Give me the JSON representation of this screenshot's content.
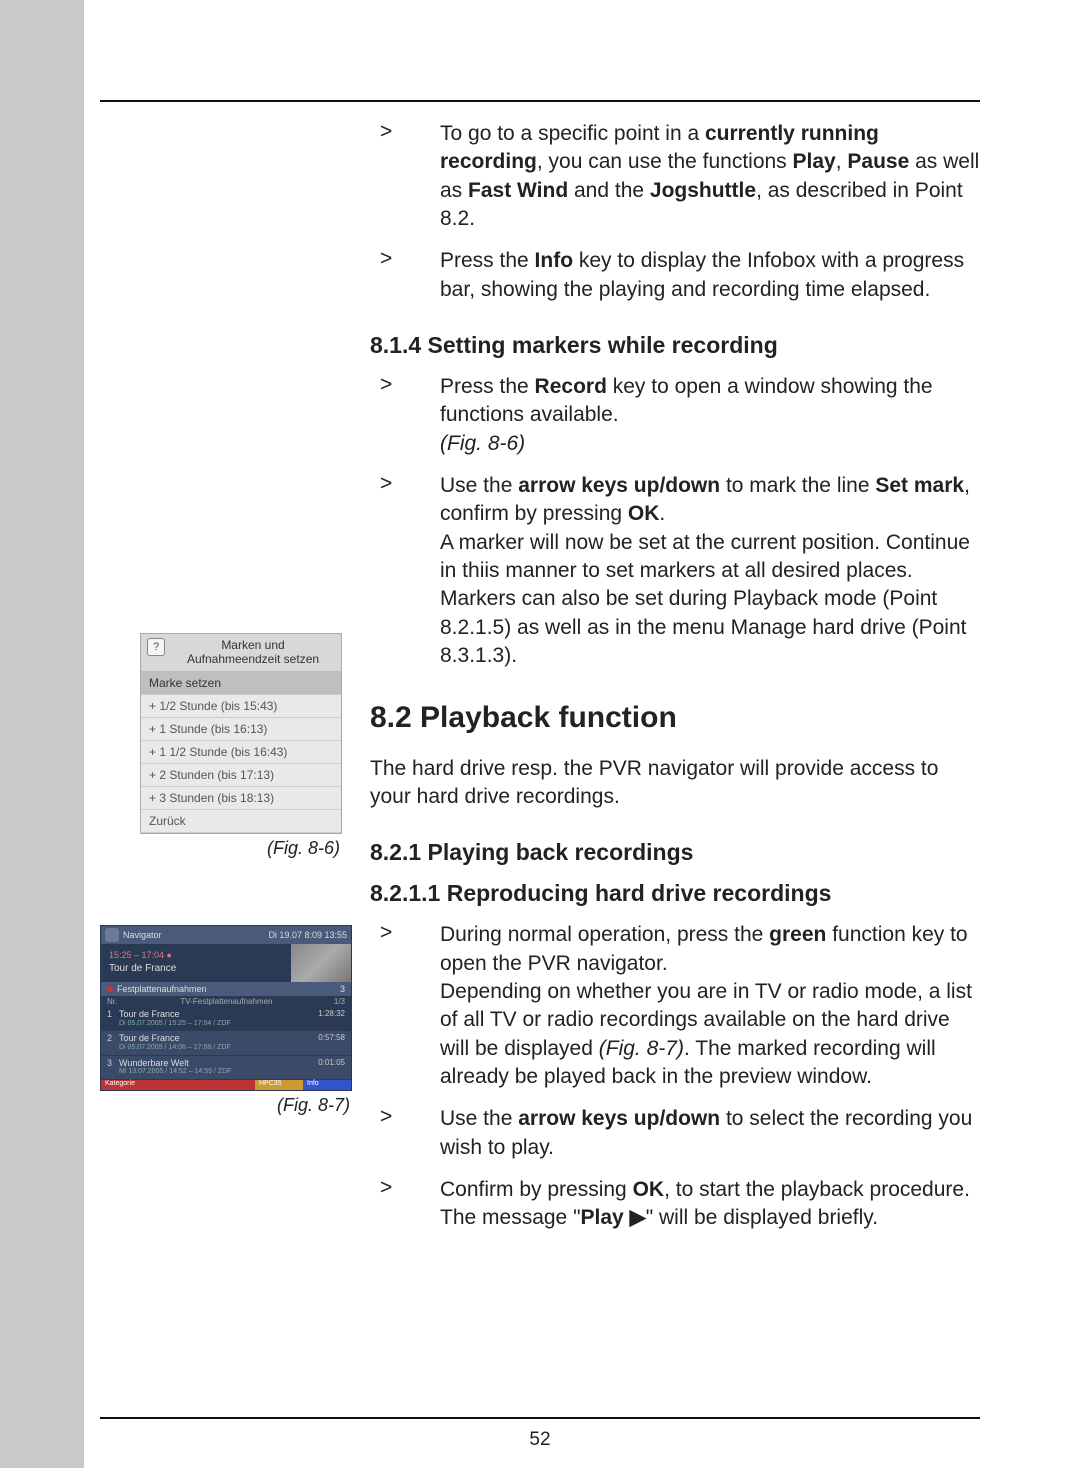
{
  "page_number": "52",
  "block1": {
    "item1": {
      "pre": "To go to a specific point in a ",
      "b1": "currently running recording",
      "mid1": ", you can use the functions ",
      "b2": "Play",
      "mid2": ", ",
      "b3": "Pause",
      "mid3": " as well as ",
      "b4": "Fast Wind",
      "mid4": " and the ",
      "b5": "Jogshuttle",
      "post": ", as described in Point 8.2."
    },
    "item2": {
      "pre": "Press the ",
      "b1": "Info",
      "post": " key to display the Infobox with a progress bar, showing the playing and recording time elapsed."
    }
  },
  "h814": "8.1.4 Setting markers while recording",
  "block814": {
    "item1": {
      "pre": "Press the ",
      "b1": "Record",
      "mid1": " key to open a window showing the functions available.",
      "figref": "(Fig. 8-6)"
    },
    "item2": {
      "pre": "Use the ",
      "b1": "arrow keys up/down",
      "mid1": " to mark the line ",
      "b2": "Set mark",
      "mid2": ", confirm by pressing ",
      "b3": "OK",
      "mid3": ".",
      "line2": "A marker will now be set at the current position. Continue in thiis manner to set markers at all desired places.",
      "line3": "Markers can also be set during Playback mode (Point 8.2.1.5) as well as in the menu Manage hard drive (Point 8.3.1.3)."
    }
  },
  "h82": "8.2 Playback function",
  "intro82": "The hard drive resp. the PVR navigator will provide access to your hard drive recordings.",
  "h821": "8.2.1 Playing back recordings",
  "h8211": "8.2.1.1 Reproducing hard drive recordings",
  "block8211": {
    "item1": {
      "pre": "During normal operation, press the ",
      "b1": "green",
      "mid1": " function key to open the PVR navigator.",
      "line2a": "Depending on whether you are in TV or radio mode, a list of all TV or radio recordings available on the hard drive will be displayed ",
      "figref": "(Fig. 8-7)",
      "line2b": ". The marked recording will already be played back in the preview window."
    },
    "item2": {
      "pre": "Use the ",
      "b1": "arrow keys up/down",
      "post": " to select the recording you wish to play."
    },
    "item3": {
      "pre": "Confirm by pressing ",
      "b1": "OK",
      "mid1": ", to start the playback procedure. The message \"",
      "b2": "Play ▶",
      "post": "\" will be displayed briefly."
    }
  },
  "fig86": {
    "caption": "(Fig. 8-6)",
    "title_line1": "Marken und",
    "title_line2": "Aufnahmeendzeit setzen",
    "items": [
      "Marke setzen",
      "+ 1/2 Stunde (bis 15:43)",
      "+ 1 Stunde (bis 16:13)",
      "+ 1 1/2 Stunde (bis 16:43)",
      "+ 2 Stunden (bis 17:13)",
      "+ 3 Stunden (bis 18:13)",
      "Zurück"
    ]
  },
  "fig87": {
    "caption": "(Fig. 8-7)",
    "nav_title": "Navigator",
    "topright": "Di 19.07 8:09   13:55",
    "timebar": "15:25 – 17:04 ●",
    "program": "Tour de France",
    "section": "Festplattenaufnahmen",
    "count": "3",
    "subhead_left": "Nr.",
    "subhead_mid": "TV-Festplattenaufnahmen",
    "subhead_right": "1/3",
    "entries": [
      {
        "num": "1",
        "title": "Tour de France",
        "sub": "Di 05.07.2005 / 15:25 – 17:04 / ZDF",
        "dur": "1:28:32"
      },
      {
        "num": "2",
        "title": "Tour de France",
        "sub": "Di 05.07.2005 / 14:06 – 17:08 / ZDF",
        "dur": "0:57:58"
      },
      {
        "num": "3",
        "title": "Wunderbare Welt",
        "sub": "Mi 13.07.2005 / 14:52 – 14:59 / ZDF",
        "dur": "0:01:05"
      }
    ],
    "bottom_left": "Kategorie",
    "bottom_mid": "HPC35",
    "bottom_right": "Info"
  }
}
